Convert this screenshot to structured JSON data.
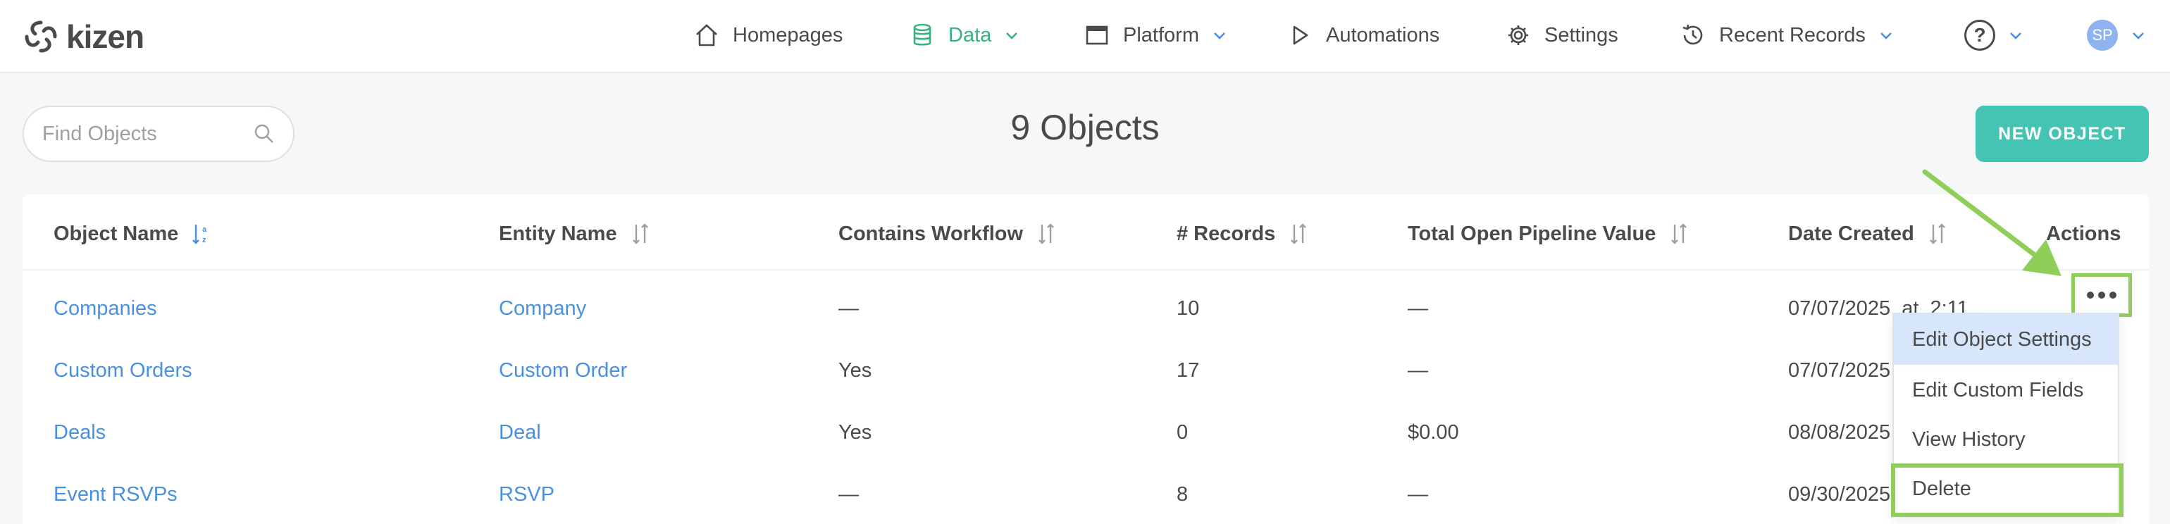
{
  "app": {
    "brand": "kizen"
  },
  "nav": {
    "homepages": "Homepages",
    "data": "Data",
    "platform": "Platform",
    "automations": "Automations",
    "settings": "Settings",
    "recent_records": "Recent Records",
    "help": "?",
    "avatar_initials": "SP"
  },
  "toolbar": {
    "search_placeholder": "Find Objects",
    "title": "9 Objects",
    "new_object_label": "NEW OBJECT"
  },
  "table": {
    "headers": {
      "object_name": "Object Name",
      "entity_name": "Entity Name",
      "contains_workflow": "Contains Workflow",
      "records": "# Records",
      "pipeline_value": "Total Open Pipeline Value",
      "date_created": "Date Created",
      "actions": "Actions"
    },
    "rows": [
      {
        "object_name": "Companies",
        "entity_name": "Company",
        "workflow": "—",
        "records": "10",
        "pipeline": "—",
        "date": "07/07/2025  at  2:11..."
      },
      {
        "object_name": "Custom Orders",
        "entity_name": "Custom Order",
        "workflow": "Yes",
        "records": "17",
        "pipeline": "—",
        "date": "07/07/2025"
      },
      {
        "object_name": "Deals",
        "entity_name": "Deal",
        "workflow": "Yes",
        "records": "0",
        "pipeline": "$0.00",
        "date": "08/08/2025"
      },
      {
        "object_name": "Event RSVPs",
        "entity_name": "RSVP",
        "workflow": "—",
        "records": "8",
        "pipeline": "—",
        "date": "09/30/2025"
      }
    ]
  },
  "actions_menu": {
    "items": [
      "Edit Object Settings",
      "Edit Custom Fields",
      "View History",
      "Delete"
    ]
  },
  "colors": {
    "accent_teal": "#45c3b3",
    "link_blue": "#4a90e2",
    "active_green": "#36b37e",
    "highlight_green": "#8fce58"
  }
}
